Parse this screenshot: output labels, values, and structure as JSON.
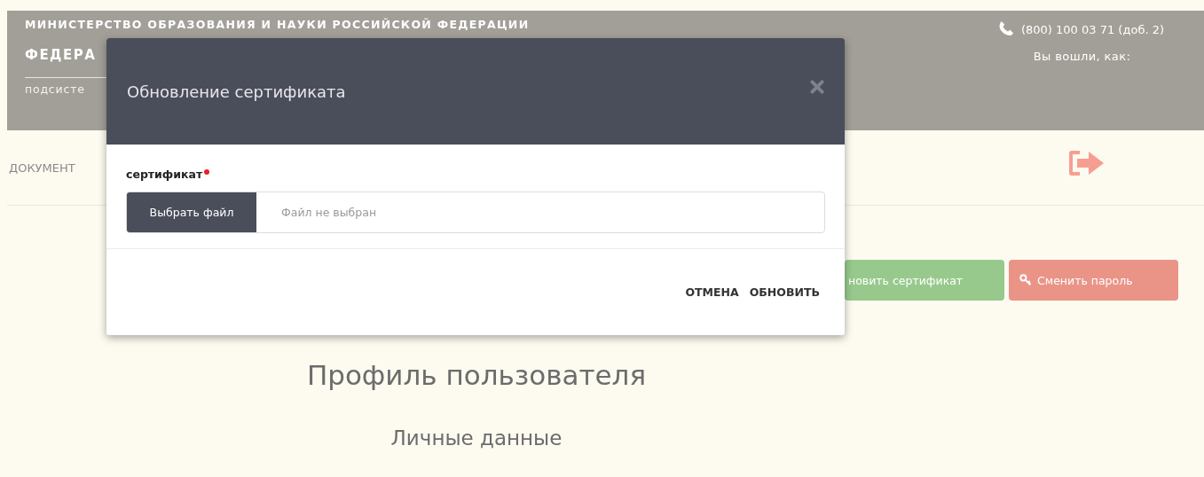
{
  "header": {
    "ministry": "МИНИСТЕРСТВО ОБРАЗОВАНИЯ И НАУКИ РОССИЙСКОЙ ФЕДЕРАЦИИ",
    "org_name": "ФЕДЕРА",
    "subsystem": "подсисте",
    "phone": "(800) 100 03 71 (доб. 2)",
    "login_label": "Вы вошли, как:"
  },
  "nav": {
    "item": "ДОКУМЕНТ"
  },
  "actions": [
    {
      "label": "новить сертификат",
      "kind": "success"
    },
    {
      "label": "Сменить пароль",
      "kind": "danger"
    }
  ],
  "page_title": "Профиль пользователя",
  "section_title": "Личные данные",
  "modal": {
    "title": "Обновление сертификата",
    "field": {
      "label": "сертификат",
      "required": true,
      "button": "Выбрать файл",
      "placeholder": "Файл не выбран"
    },
    "buttons": [
      "ОТМЕНА",
      "ОБНОВИТЬ"
    ]
  }
}
